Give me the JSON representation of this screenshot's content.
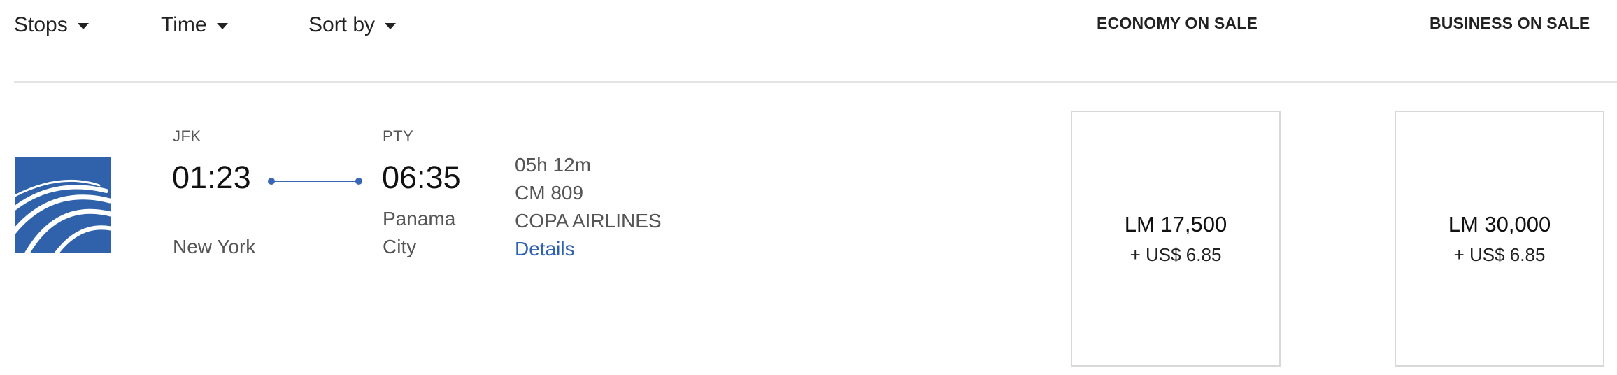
{
  "filters": [
    {
      "label": "Stops"
    },
    {
      "label": "Time"
    },
    {
      "label": "Sort by"
    }
  ],
  "columns": {
    "economy": "ECONOMY ON SALE",
    "business": "BUSINESS ON SALE"
  },
  "flight": {
    "airline_logo": "copa-airlines-logo",
    "origin": {
      "code": "JFK",
      "time": "01:23",
      "city": "New York"
    },
    "destination": {
      "code": "PTY",
      "time": "06:35",
      "city_line1": "Panama",
      "city_line2": "City"
    },
    "duration": "05h 12m",
    "flight_number": "CM 809",
    "airline": "COPA AIRLINES",
    "details_label": "Details"
  },
  "fares": {
    "economy": {
      "miles": "LM 17,500",
      "cash": "+ US$ 6.85"
    },
    "business": {
      "miles": "LM 30,000",
      "cash": "+ US$ 6.85"
    }
  },
  "colors": {
    "accent": "#2f62ab",
    "link": "#2f62b3"
  }
}
